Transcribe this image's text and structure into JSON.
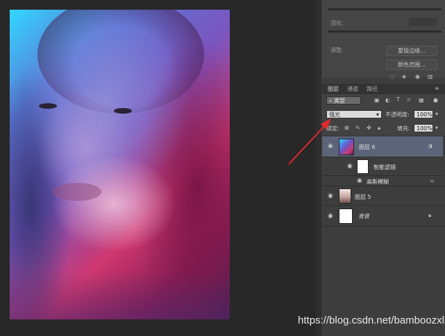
{
  "adjust_panel": {
    "row1_label": "羽化:",
    "row2_label": "调整:",
    "button_edge": "蒙版边缘...",
    "button_color": "颜色范围..."
  },
  "tabs": [
    "图层",
    "通道",
    "路径"
  ],
  "filter": {
    "kind_value": "类型",
    "icons": [
      "image-filter-icon",
      "adjustment-filter-icon",
      "type-filter-icon",
      "shape-filter-icon",
      "smartobject-filter-icon"
    ]
  },
  "blend": {
    "mode_value": "强光",
    "opacity_label": "不透明度:",
    "opacity_value": "100%",
    "lock_label": "锁定:",
    "fill_label": "填充:",
    "fill_value": "100%"
  },
  "layers": [
    {
      "name": "图层 6",
      "selected": true
    },
    {
      "name": "智能滤镜",
      "sub": true
    },
    {
      "name": "高斯模糊",
      "sub": true
    },
    {
      "name": "图层 5",
      "selected": false
    },
    {
      "name": "背景",
      "selected": false,
      "italic": true
    }
  ],
  "watermark": "https://blog.csdn.net/bamboozxl",
  "colors": {
    "accent_arrow": "#e5282a",
    "panel_bg": "#3d3d3d",
    "selected_row": "#5b6478"
  }
}
